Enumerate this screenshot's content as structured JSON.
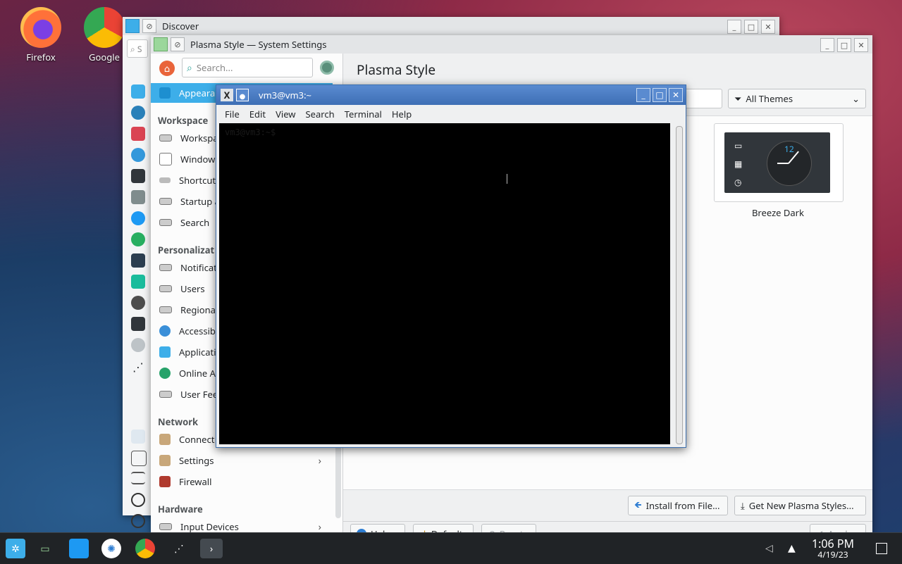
{
  "desktop": {
    "icons": [
      {
        "label": "Firefox"
      },
      {
        "label": "Google"
      }
    ]
  },
  "discover": {
    "title": "Discover",
    "search_placeholder": "S"
  },
  "settings": {
    "title": "Plasma Style — System Settings",
    "search_placeholder": "Search...",
    "page_title": "Plasma Style",
    "active_item": "Appeara",
    "categories": {
      "workspace": "Workspace",
      "personalization": "Personalizat",
      "network": "Network",
      "hardware": "Hardware"
    },
    "workspace_items": [
      "Workspa",
      "Window",
      "Shortcut",
      "Startup a",
      "Search"
    ],
    "personalization_items": [
      "Notificat",
      "Users",
      "Regiona",
      "Accessib",
      "Applicati",
      "Online A",
      "User Fee"
    ],
    "network_items": [
      "Connect",
      "Settings",
      "Firewall"
    ],
    "hardware_items": [
      "Input Devices"
    ],
    "filter": "All Themes",
    "theme_card": {
      "label": "Breeze Dark",
      "clock": "12"
    },
    "buttons": {
      "install": "Install from File...",
      "get_new": "Get New Plasma Styles...",
      "help": "Help",
      "defaults": "Defaults",
      "reset": "Reset",
      "apply": "Apply"
    }
  },
  "terminal": {
    "title": "vm3@vm3:~",
    "menu": [
      "File",
      "Edit",
      "View",
      "Search",
      "Terminal",
      "Help"
    ],
    "prompt": "vm3@vm3:~$"
  },
  "taskbar": {
    "time": "1:06 PM",
    "date": "4/19/23"
  }
}
